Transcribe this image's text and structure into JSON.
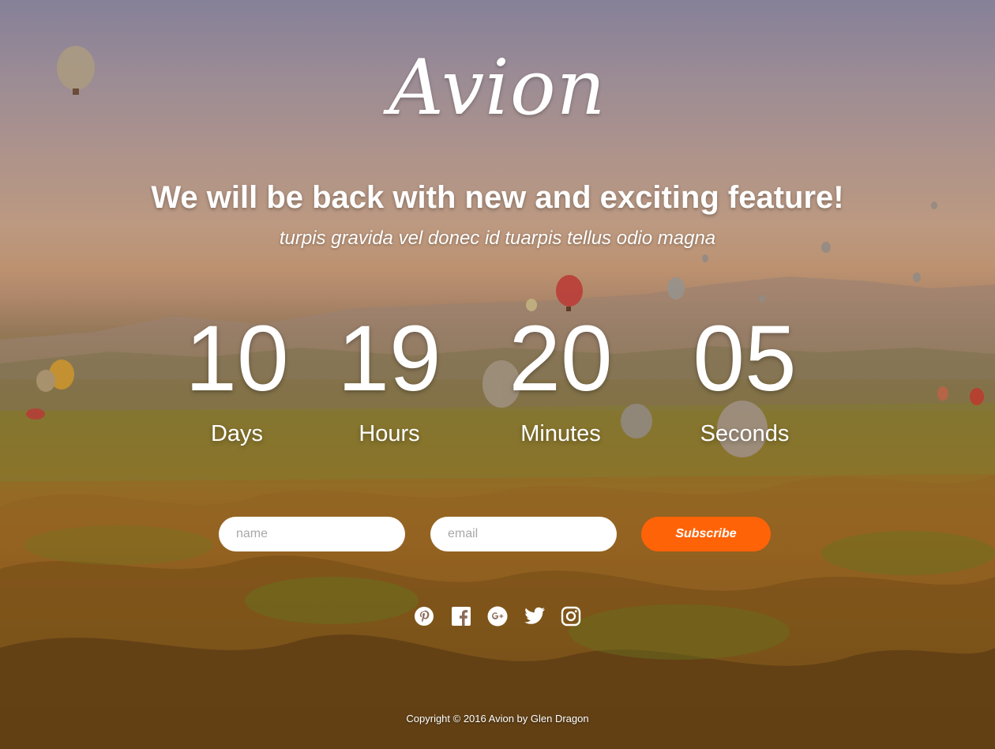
{
  "brand": {
    "logo_text": "Avion"
  },
  "hero": {
    "headline": "We will be back with new and exciting feature!",
    "subline": "turpis gravida vel donec id tuarpis tellus odio magna"
  },
  "countdown": [
    {
      "value": "10",
      "label": "Days"
    },
    {
      "value": "19",
      "label": "Hours"
    },
    {
      "value": "20",
      "label": "Minutes"
    },
    {
      "value": "05",
      "label": "Seconds"
    }
  ],
  "form": {
    "name_placeholder": "name",
    "email_placeholder": "email",
    "subscribe_label": "Subscribe"
  },
  "social": [
    "pinterest-icon",
    "facebook-icon",
    "google-plus-icon",
    "twitter-icon",
    "instagram-icon"
  ],
  "colors": {
    "accent": "#ff6308",
    "text": "#ffffff",
    "input_bg": "#ffffff"
  },
  "footer": {
    "copyright": "Copyright © 2016 Avion by Glen Dragon"
  }
}
